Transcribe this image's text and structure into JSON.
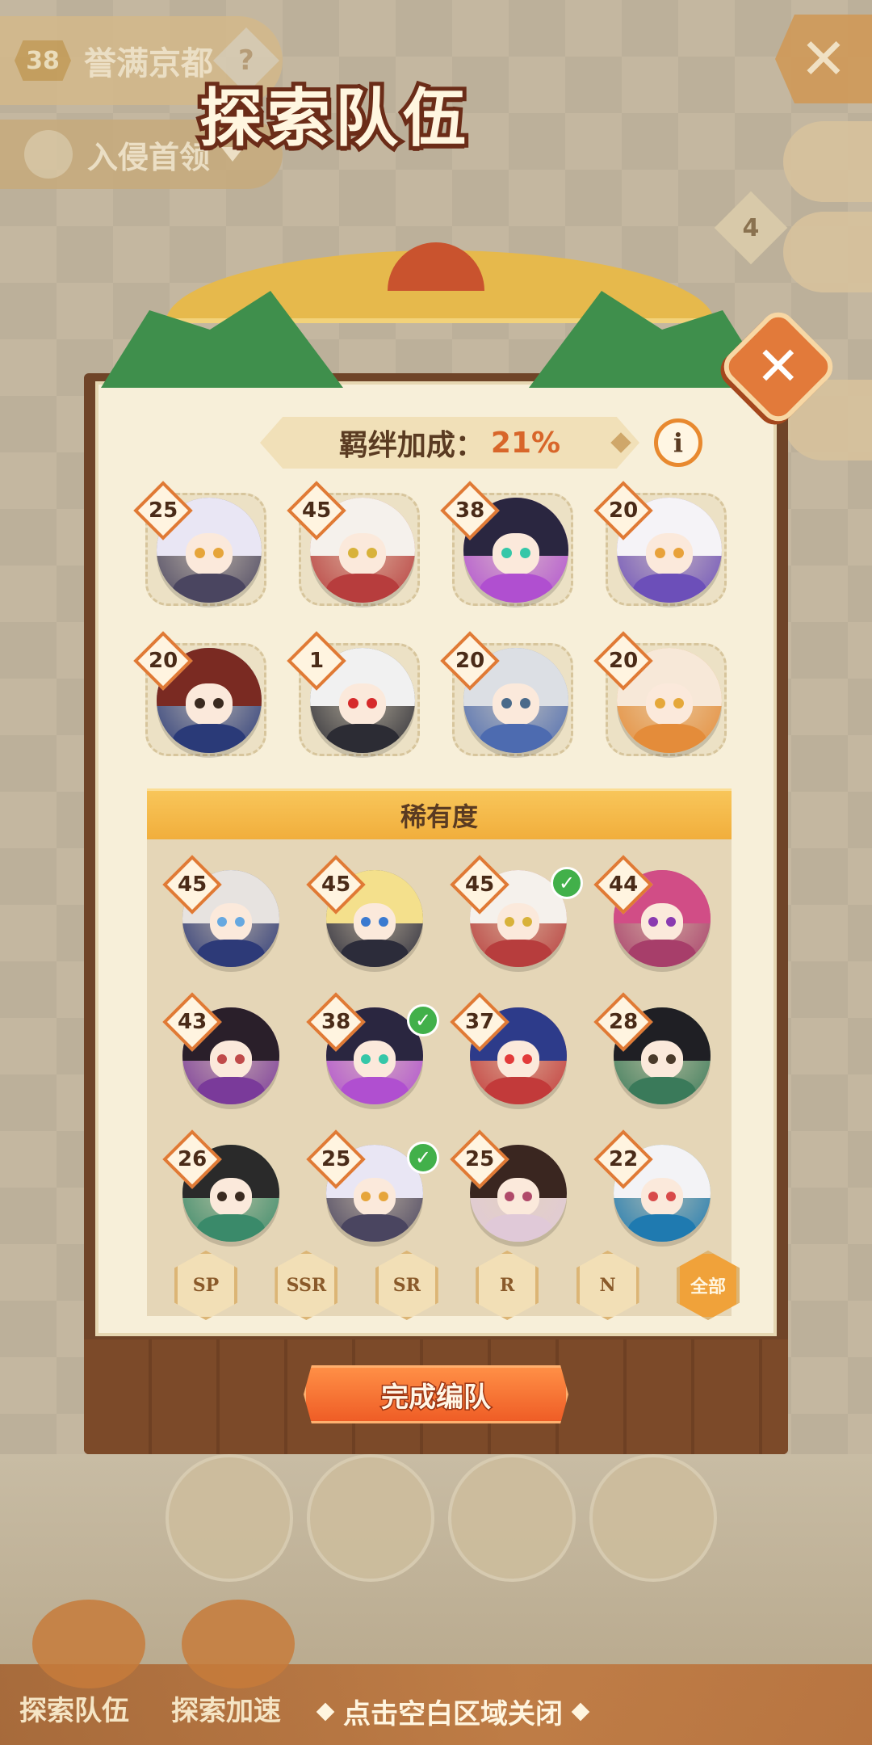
{
  "background": {
    "stage_level": "38",
    "stage_title": "誉满京都",
    "help_icon": "question-icon",
    "dropdown_label": "入侵首领",
    "side_badge": "4",
    "bottom_left_label": "探索队伍",
    "bottom_mid_label": "探索加速"
  },
  "modal": {
    "title": "探索队伍",
    "bond_label": "羁绊加成：",
    "bond_value": "21%",
    "info_label": "i",
    "team": [
      {
        "level": "25",
        "hair": "#e9e6f4",
        "body": "#4a4560",
        "eye": "#e6a53a"
      },
      {
        "level": "45",
        "hair": "#f5f1ec",
        "body": "#b73d3d",
        "eye": "#d8b23a"
      },
      {
        "level": "38",
        "hair": "#2a2640",
        "body": "#b04fd0",
        "eye": "#35c7a8"
      },
      {
        "level": "20",
        "hair": "#f5f3f7",
        "body": "#6c4fb9",
        "eye": "#e8a23a"
      },
      {
        "level": "20",
        "hair": "#7a2a22",
        "body": "#2a3a78",
        "eye": "#3a2a20"
      },
      {
        "level": "1",
        "hair": "#f1f1f1",
        "body": "#2c2c34",
        "eye": "#d62a2a"
      },
      {
        "level": "20",
        "hair": "#dcdfe4",
        "body": "#4d6bb0",
        "eye": "#4a6a8a"
      },
      {
        "level": "20",
        "hair": "#f7e8d8",
        "body": "#e48c3a",
        "eye": "#e5a83a"
      }
    ],
    "rarity_header": "稀有度",
    "roster": [
      {
        "level": "45",
        "checked": false,
        "hair": "#e7e3e0",
        "body": "#2d3a78",
        "eye": "#66a8e0"
      },
      {
        "level": "45",
        "checked": false,
        "hair": "#f4e08c",
        "body": "#2c2c3a",
        "eye": "#3a7ad0"
      },
      {
        "level": "45",
        "checked": true,
        "hair": "#f5f1ec",
        "body": "#b73d3d",
        "eye": "#d8b23a"
      },
      {
        "level": "44",
        "checked": false,
        "hair": "#d14d86",
        "body": "#a73e6a",
        "eye": "#8a3ab0"
      },
      {
        "level": "43",
        "checked": false,
        "hair": "#2a1f2a",
        "body": "#7a3a9a",
        "eye": "#c04a4a"
      },
      {
        "level": "38",
        "checked": true,
        "hair": "#2a2640",
        "body": "#b04fd0",
        "eye": "#35c7a8"
      },
      {
        "level": "37",
        "checked": false,
        "hair": "#2d3b8a",
        "body": "#c23a3a",
        "eye": "#e23a3a"
      },
      {
        "level": "28",
        "checked": false,
        "hair": "#1f1f24",
        "body": "#3a7a5a",
        "eye": "#4a3a2a"
      },
      {
        "level": "26",
        "checked": false,
        "hair": "#2a2a2a",
        "body": "#3a8a6a",
        "eye": "#3a2a20"
      },
      {
        "level": "25",
        "checked": true,
        "hair": "#e9e6f4",
        "body": "#4a4560",
        "eye": "#e6a53a"
      },
      {
        "level": "25",
        "checked": false,
        "hair": "#3a2620",
        "body": "#e0c9d8",
        "eye": "#b04a6a"
      },
      {
        "level": "22",
        "checked": false,
        "hair": "#f3f3f6",
        "body": "#1f7ab0",
        "eye": "#d84a4a"
      }
    ],
    "filters": [
      "SP",
      "SSR",
      "SR",
      "R",
      "N",
      "全部"
    ],
    "active_filter": "全部",
    "done_button": "完成编队"
  },
  "close_hint": "点击空白区域关闭",
  "colors": {
    "accent_orange": "#ef5d26",
    "level_border": "#e07a35",
    "check_green": "#42b04a",
    "panel_wood": "#6f4428"
  }
}
